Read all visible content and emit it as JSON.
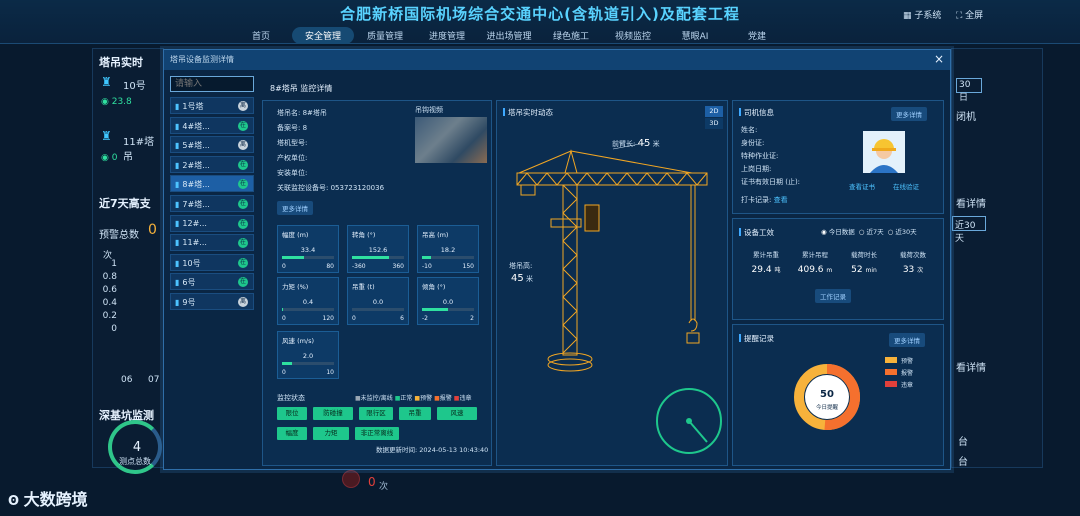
{
  "header": {
    "title": "合肥新桥国际机场综合交通中心(含轨道引入)及配套工程",
    "subsystem": "子系统",
    "fullscreen": "全屏",
    "nav": [
      "首页",
      "安全管理",
      "质量管理",
      "进度管理",
      "进出场管理",
      "绿色施工",
      "视频监控",
      "慧眼AI",
      "党建"
    ]
  },
  "background": {
    "tower_panel_title": "塔吊实时",
    "tower10": "10号",
    "tower10_val": "23.8",
    "tower11": "11#塔吊",
    "tower11_val": "0",
    "week_title": "近7天高支",
    "warn_total_label": "预警总数",
    "warn_total": "0",
    "axis_unit": "次",
    "yticks": [
      "1",
      "0.8",
      "0.6",
      "0.4",
      "0.2",
      "0"
    ],
    "xticks": [
      "06",
      "07"
    ],
    "pit_title": "深基坑监测",
    "points_total": "4",
    "points_label": "测点总数",
    "alarm_count": "0",
    "alarm_unit": "次",
    "right_date": "30日",
    "right_label": "闭机",
    "more_detail": "看详情",
    "thirty": "近30天",
    "tai": "台",
    "logo_text": "大数跨境"
  },
  "modal": {
    "title": "塔吊设备监测详情",
    "close": "×",
    "search_placeholder": "请输入",
    "list": [
      {
        "label": "1号塔",
        "status": "离"
      },
      {
        "label": "4#塔...",
        "status": "在"
      },
      {
        "label": "5#塔...",
        "status": "离"
      },
      {
        "label": "2#塔...",
        "status": "在"
      },
      {
        "label": "8#塔...",
        "status": "在"
      },
      {
        "label": "7#塔...",
        "status": "在"
      },
      {
        "label": "12#...",
        "status": "在"
      },
      {
        "label": "11#...",
        "status": "在"
      },
      {
        "label": "10号",
        "status": "在"
      },
      {
        "label": "6号",
        "status": "在"
      },
      {
        "label": "9号",
        "status": "离"
      }
    ],
    "detail_title": "8#塔吊 监控详情",
    "info": {
      "name_label": "塔吊名:",
      "name": "8#塔吊",
      "record_label": "备案号:",
      "record": "8",
      "model_label": "塔机型号:",
      "model": "",
      "owner_label": "产权单位:",
      "owner": "",
      "install_label": "安装单位:",
      "install": "",
      "device_label": "关联监控设备号:",
      "device": "053723120036",
      "video_label": "吊钩视频",
      "more": "更多详情"
    },
    "gauges": [
      {
        "label": "幅度 (m)",
        "value": "33.4",
        "min": "0",
        "max": "80",
        "fraction": 0.42
      },
      {
        "label": "转角 (°)",
        "value": "152.6",
        "min": "-360",
        "max": "360",
        "fraction": 0.71
      },
      {
        "label": "吊高 (m)",
        "value": "18.2",
        "min": "-10",
        "max": "150",
        "fraction": 0.18
      },
      {
        "label": "力矩 (%)",
        "value": "0.4",
        "min": "0",
        "max": "120",
        "fraction": 0.01
      },
      {
        "label": "吊重 (t)",
        "value": "0.0",
        "min": "0",
        "max": "6",
        "fraction": 0.0
      },
      {
        "label": "倾角 (°)",
        "value": "0.0",
        "min": "-2",
        "max": "2",
        "fraction": 0.5
      },
      {
        "label": "风速 (m/s)",
        "value": "2.0",
        "min": "0",
        "max": "10",
        "fraction": 0.2
      }
    ],
    "monitor": {
      "label": "监控状态",
      "legend": [
        "未监控/离线",
        "正常",
        "预警",
        "报警",
        "违章"
      ],
      "legend_colors": [
        "#9aa7b4",
        "#1ec78c",
        "#f7b23b",
        "#f5702e",
        "#e2403b"
      ],
      "buttons": [
        "限位",
        "防碰撞",
        "限行区",
        "吊重",
        "风速",
        "幅度",
        "力矩",
        "非正常离线"
      ],
      "update_label": "数据更新时间:",
      "update_time": "2024-05-13 10:43:40"
    },
    "crane": {
      "title": "塔吊实时动态",
      "view_2d": "2D",
      "view_3d": "3D",
      "jib_label": "前臂长:",
      "jib_value": "45",
      "jib_unit": "米",
      "height_label": "塔吊高:",
      "height_value": "45",
      "height_unit": "米"
    },
    "driver": {
      "title": "司机信息",
      "more": "更多详情",
      "name_label": "姓名:",
      "id_label": "身份证:",
      "cert_label": "特种作业证:",
      "date_label": "上岗日期:",
      "expire_label": "证书有效日期 (止):",
      "checkin_label": "打卡记录:",
      "checkin_link": "查看",
      "view_cert": "查看证书",
      "face_verify": "在线验证"
    },
    "efficiency": {
      "title": "设备工效",
      "radios": [
        "今日数据",
        "近7天",
        "近30天"
      ],
      "metrics": [
        {
          "label": "累计吊重",
          "value": "29.4",
          "unit": "吨"
        },
        {
          "label": "累计吊程",
          "value": "409.6",
          "unit": "m"
        },
        {
          "label": "载荷时长",
          "value": "52",
          "unit": "min"
        },
        {
          "label": "载荷次数",
          "value": "33",
          "unit": "次"
        }
      ],
      "record_btn": "工作记录"
    },
    "alarm": {
      "title": "提醒记录",
      "more": "更多详情",
      "center_value": "50",
      "center_label": "今日提醒",
      "legend": [
        "预警",
        "报警",
        "违章"
      ],
      "legend_colors": [
        "#f7b23b",
        "#f5702e",
        "#e2403b"
      ]
    }
  }
}
